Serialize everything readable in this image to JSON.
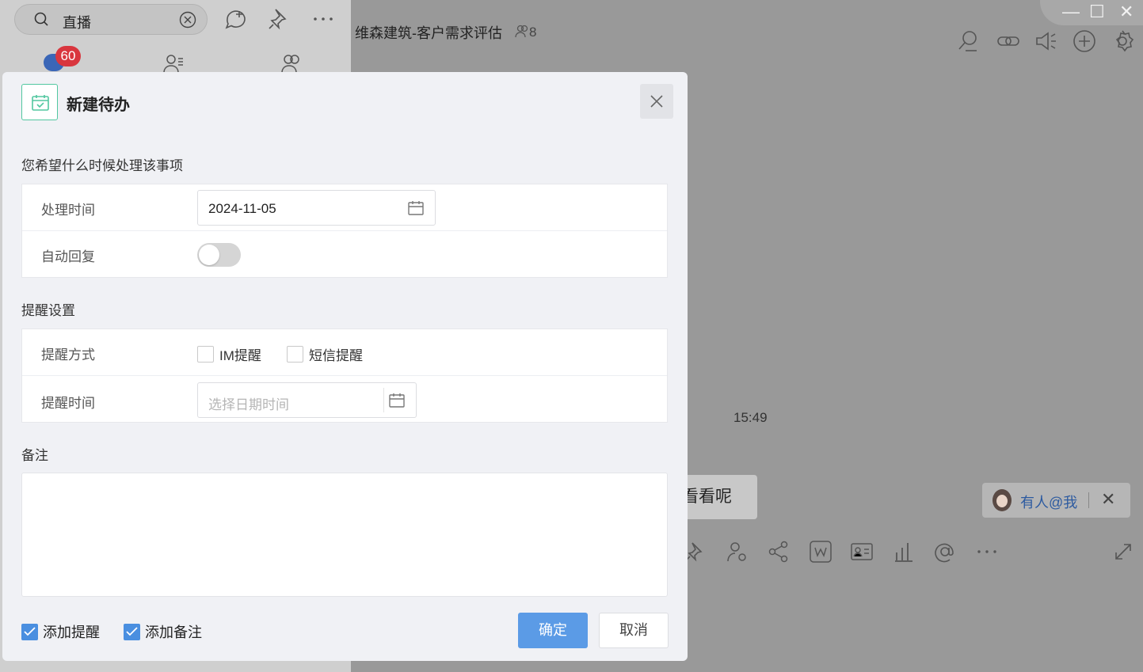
{
  "background": {
    "search": {
      "value": "直播"
    },
    "badge_count": "60",
    "chat_title": "维森建筑-客户需求评估",
    "member_count": "8",
    "time_label": "15:49",
    "message_text": "看看呢",
    "at_me_label": "有人@我"
  },
  "dialog": {
    "title": "新建待办",
    "section_when": "您希望什么时候处理该事项",
    "process_time_label": "处理时间",
    "process_time_value": "2024-11-05",
    "auto_reply_label": "自动回复",
    "auto_reply_on": false,
    "section_reminder": "提醒设置",
    "reminder_method_label": "提醒方式",
    "reminder_options": [
      {
        "label": "IM提醒",
        "checked": false
      },
      {
        "label": "短信提醒",
        "checked": false
      }
    ],
    "reminder_time_label": "提醒时间",
    "reminder_time_placeholder": "选择日期时间",
    "section_note": "备注",
    "note_value": "",
    "footer_checks": [
      {
        "label": "添加提醒",
        "checked": true
      },
      {
        "label": "添加备注",
        "checked": true
      }
    ],
    "confirm_label": "确定",
    "cancel_label": "取消"
  },
  "colors": {
    "accent": "#5b9be6",
    "calendar_icon": "#52c7a0",
    "overlay_bg": "#999999"
  }
}
